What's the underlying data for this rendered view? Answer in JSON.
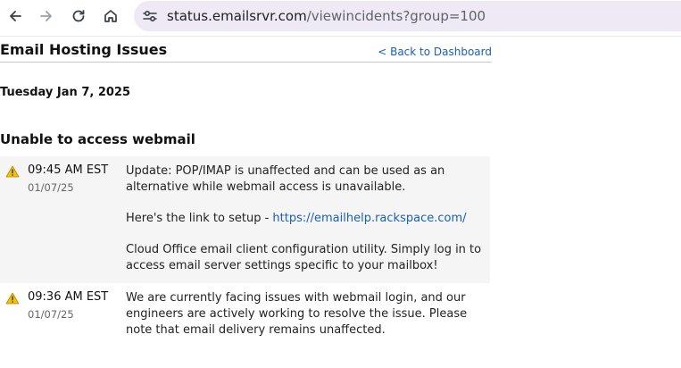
{
  "browser": {
    "url_host": "status.emailsrvr.com",
    "url_path": "/viewincidents?group=100",
    "icons": [
      "back-arrow-icon",
      "forward-arrow-icon",
      "reload-icon",
      "home-icon",
      "site-info-icon"
    ]
  },
  "page": {
    "title": "Email Hosting Issues",
    "back_link": "< Back to Dashboard",
    "date_heading": "Tuesday Jan 7, 2025"
  },
  "incident": {
    "title": "Unable to access webmail",
    "updates": [
      {
        "time": "09:45 AM EST",
        "date": "01/07/25",
        "para1": "Update: POP/IMAP is unaffected and can be used as an alternative while webmail access is unavailable.",
        "para2_prefix": "Here's the link to setup - ",
        "para2_link": "https://emailhelp.rackspace.com/",
        "para3": "Cloud Office email client configuration utility. Simply log in to access email server settings specific to your mailbox!"
      },
      {
        "time": "09:36 AM EST",
        "date": "01/07/25",
        "para1": "We are currently facing issues with webmail login, and our engineers are actively working to resolve the issue. Please note that email delivery remains unaffected."
      }
    ]
  },
  "colors": {
    "link": "#1a5fb4",
    "shaded_row": "#f5f5f5",
    "warning": "#f2c200",
    "omnibox": "#efe9f6"
  }
}
